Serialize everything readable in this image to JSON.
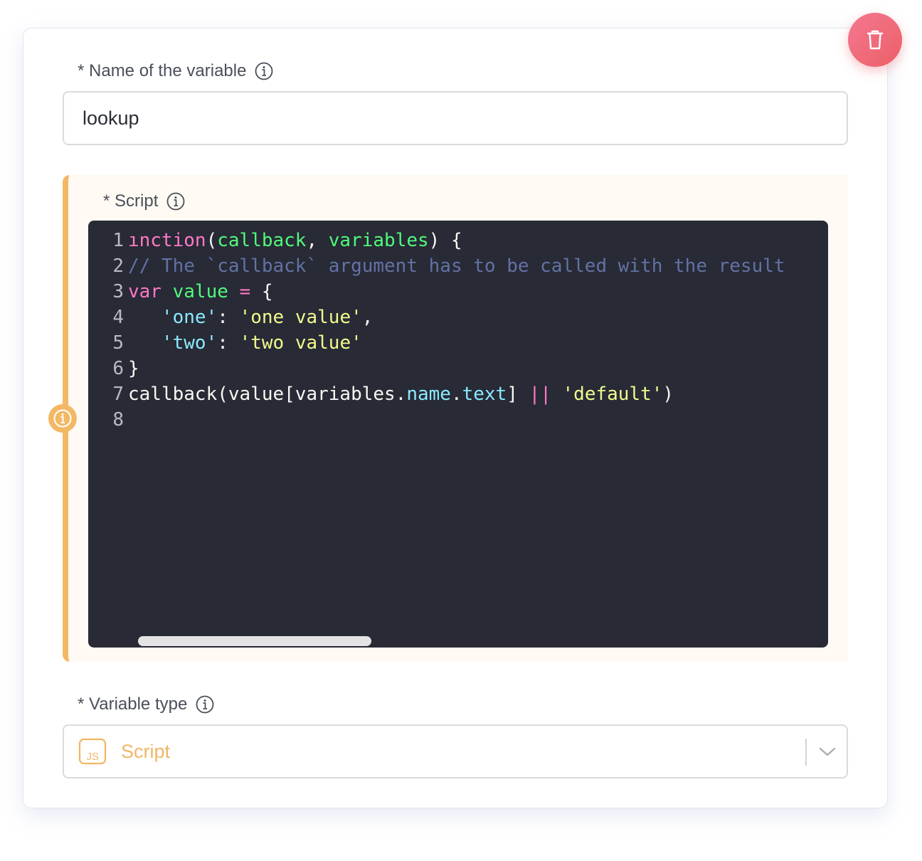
{
  "variable_name": {
    "label": "* Name of the variable",
    "value": "lookup"
  },
  "script": {
    "label": "* Script",
    "lines": [
      {
        "n": "1"
      },
      {
        "n": "2"
      },
      {
        "n": "3"
      },
      {
        "n": "4"
      },
      {
        "n": "5"
      },
      {
        "n": "6"
      },
      {
        "n": "7"
      },
      {
        "n": "8"
      }
    ],
    "code": {
      "l1_fn": "ınction",
      "l1_open": "(",
      "l1_p1": "callback",
      "l1_comma": ", ",
      "l1_p2": "variables",
      "l1_close": ") {",
      "l2_comment": "// The `callback` argument has to be called with the result",
      "l3_kw": "var",
      "l3_name": "value",
      "l3_op": " = ",
      "l3_brace": "{",
      "l4_key": "'one'",
      "l4_colon": ": ",
      "l4_val": "'one value'",
      "l4_comma": ",",
      "l5_key": "'two'",
      "l5_colon": ": ",
      "l5_val": "'two value'",
      "l6_brace": "}",
      "l7_a": "callback(value[variables.",
      "l7_prop1": "name",
      "l7_dot": ".",
      "l7_prop2": "text",
      "l7_b": "] ",
      "l7_or": "||",
      "l7_sp": " ",
      "l7_str": "'default'",
      "l7_c": ")"
    }
  },
  "variable_type": {
    "label": "* Variable type",
    "value": "Script",
    "badge": "JS"
  },
  "icons": {
    "delete": "trash-icon",
    "info": "info-icon",
    "warning": "info-circle-icon",
    "chevron": "chevron-down-icon"
  },
  "colors": {
    "accent_orange": "#f3b866",
    "delete_red": "#ec5f66",
    "editor_bg": "#282a36"
  }
}
